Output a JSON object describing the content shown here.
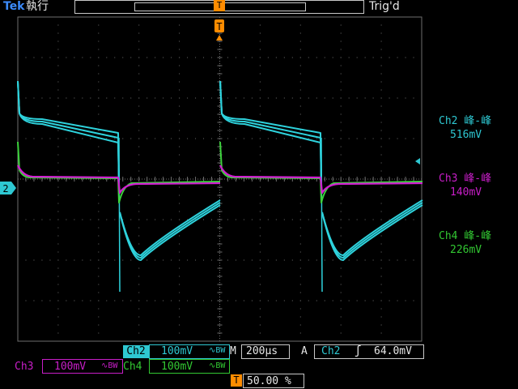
{
  "header": {
    "brand": "Tek",
    "run_state": "執行",
    "trigger_status": "Trig'd",
    "trigger_marker": "T"
  },
  "channel_marker": "2",
  "measurements": [
    {
      "label": "Ch2 峰-峰",
      "value": "516mV",
      "color": "#2ec8d2"
    },
    {
      "label": "Ch3 峰-峰",
      "value": "140mV",
      "color": "#c81ec8"
    },
    {
      "label": "Ch4 峰-峰",
      "value": "226mV",
      "color": "#32c832"
    }
  ],
  "footer": {
    "ch2": {
      "name": "Ch2",
      "scale": "100mV",
      "coupling": "∿BW"
    },
    "ch3": {
      "name": "Ch3",
      "scale": "100mV",
      "coupling": "∿BW"
    },
    "ch4": {
      "name": "Ch4",
      "scale": "100mV",
      "coupling": "∿BW"
    },
    "timebase_prefix": "M",
    "timebase": "200µs",
    "trigger_mode": "A",
    "trigger_source": "Ch2",
    "trigger_slope": "ʃ",
    "trigger_level": "64.0mV",
    "trigger_position_marker": "T",
    "trigger_position": "50.00 %"
  },
  "colors": {
    "ch2": "#2ed2dc",
    "ch3": "#d21ed2",
    "ch4": "#3cd23c",
    "grid": "#6e6e6e",
    "trigger": "#ff8c00",
    "brand": "#3c8cff"
  }
}
